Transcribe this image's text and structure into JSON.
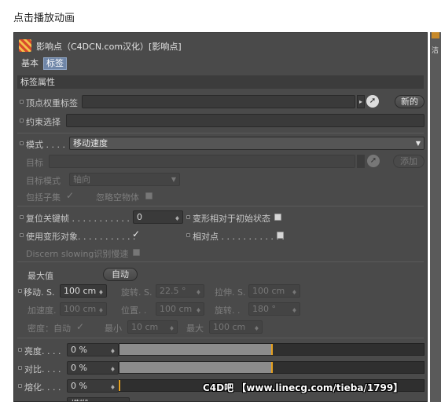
{
  "caption": "点击播放动画",
  "header": {
    "title": "影响点（C4DCN.com汉化）[影响点]"
  },
  "tabs": [
    {
      "label": "基本"
    },
    {
      "label": "标签"
    }
  ],
  "section_title": "标签属性",
  "vertex_weight": {
    "label": "顶点权重标签",
    "button": "新的"
  },
  "constraint": {
    "label": "约束选择"
  },
  "mode": {
    "label": "模式 . . . .",
    "value": "移动速度"
  },
  "target": {
    "label": "目标",
    "button": "添加"
  },
  "target_mode": {
    "label": "目标模式",
    "value": "轴向"
  },
  "include_children": {
    "label": "包括子集",
    "check": "✓",
    "ignore_label": "忽略空物体"
  },
  "reset_keyframe": {
    "label": "复位关键帧 . . . . . . . . . . . .",
    "value": "0"
  },
  "deform_relative": {
    "label": "变形相对于初始状态"
  },
  "use_deformed": {
    "label": "使用变形对象. . . . . . . . . . .",
    "check": "✓"
  },
  "relative_point": {
    "label": "相对点 . . . . . . . . . . . ."
  },
  "discern_slowing": {
    "label": "Discern slowing识别慢速"
  },
  "max_value": {
    "label": "最大值",
    "button": "自动"
  },
  "move_row": {
    "move_label": "移动. S.",
    "move_value": "100 cm",
    "rot_label": "旋转. S.",
    "rot_value": "22.5 °",
    "stretch_label": "拉伸. S.",
    "stretch_value": "100 cm"
  },
  "accel_row": {
    "accel_label": "加速度.",
    "accel_value": "100 cm",
    "pos_label": "位置. .",
    "pos_value": "100 cm",
    "rot_label": "旋转. .",
    "rot_value": "180 °"
  },
  "density_row": {
    "density_label": "密度：自动",
    "density_check": "✓",
    "min_label": "最小",
    "min_value": "10 cm",
    "max_label": "最大",
    "max_value": "100 cm"
  },
  "sliders": [
    {
      "label": "亮度. . . .",
      "value": "0 %",
      "fill": 0.5
    },
    {
      "label": "对比. . . .",
      "value": "0 %",
      "fill": 0.5
    },
    {
      "label": "熔化. . . .",
      "value": "0 %",
      "fill": 0.0
    }
  ],
  "bottom_partial": {
    "value": "模糊"
  },
  "watermark": "C4D吧 【www.linecg.com/tieba/1799】",
  "colors": {
    "panel_bg": "#4a4a4a",
    "field_bg": "#3a3a3a",
    "tab_active": "#6f86a8",
    "slider_mark": "#e6a11f"
  },
  "icons": [
    "c4d-tag-icon",
    "dropdown-arrow-icon",
    "pick-arrow-icon",
    "checkbox-icon",
    "spin-arrows-icon"
  ]
}
